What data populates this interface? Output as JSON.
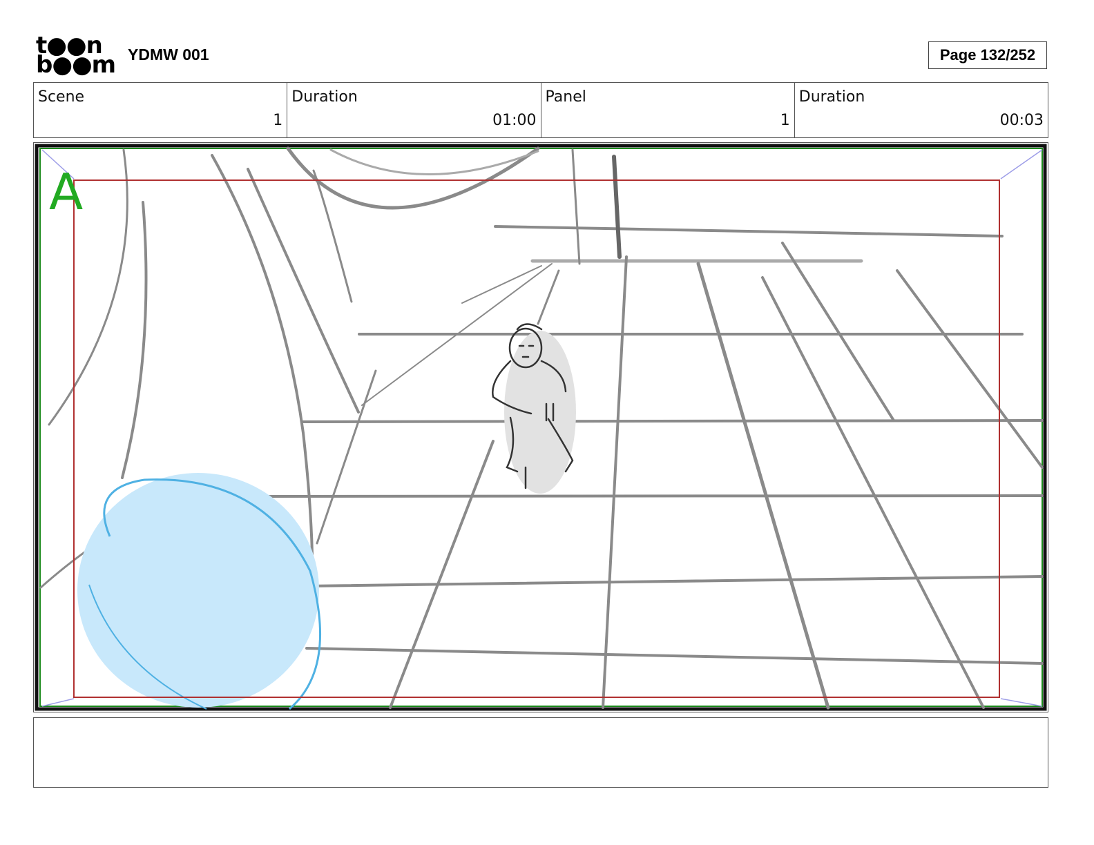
{
  "header": {
    "logo_line1": "t●●n",
    "logo_line2": "b●●m",
    "project_title": "YDMW 001",
    "page_indicator": "Page 132/252"
  },
  "info": {
    "scene_label": "Scene",
    "scene_value": "1",
    "scene_duration_label": "Duration",
    "scene_duration_value": "01:00",
    "panel_label": "Panel",
    "panel_value": "1",
    "panel_duration_label": "Duration",
    "panel_duration_value": "00:03"
  },
  "panel": {
    "layer_marker": "A",
    "colors": {
      "frame_border": "#111111",
      "safe_area": "#b03030",
      "camera_frame": "#1a8a1a",
      "layer_marker": "#22aa22",
      "sketch": "#8a8a8a",
      "blue_blob": "#c8e8fb"
    },
    "icons": [
      "corner-arrow-icon"
    ]
  },
  "notes": {
    "text": ""
  }
}
